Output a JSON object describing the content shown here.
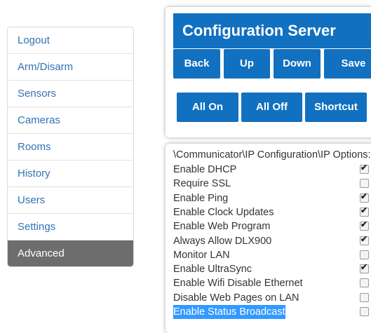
{
  "nav": {
    "items": [
      {
        "label": "Logout",
        "active": false
      },
      {
        "label": "Arm/Disarm",
        "active": false
      },
      {
        "label": "Sensors",
        "active": false
      },
      {
        "label": "Cameras",
        "active": false
      },
      {
        "label": "Rooms",
        "active": false
      },
      {
        "label": "History",
        "active": false
      },
      {
        "label": "Users",
        "active": false
      },
      {
        "label": "Settings",
        "active": false
      },
      {
        "label": "Advanced",
        "active": true
      }
    ]
  },
  "config": {
    "title": "Configuration Server",
    "buttons": {
      "back": "Back",
      "up": "Up",
      "down": "Down",
      "save": "Save",
      "all_on": "All On",
      "all_off": "All Off",
      "shortcut": "Shortcut"
    }
  },
  "options": {
    "path": "\\Communicator\\IP Configuration\\IP Options:",
    "items": [
      {
        "label": "Enable DHCP",
        "checked": true
      },
      {
        "label": "Require SSL",
        "checked": false
      },
      {
        "label": "Enable Ping",
        "checked": true
      },
      {
        "label": "Enable Clock Updates",
        "checked": true
      },
      {
        "label": "Enable Web Program",
        "checked": true
      },
      {
        "label": "Always Allow DLX900",
        "checked": true
      },
      {
        "label": "Monitor LAN",
        "checked": false
      },
      {
        "label": "Enable UltraSync",
        "checked": true
      },
      {
        "label": "Enable Wifi Disable Ethernet",
        "checked": false
      },
      {
        "label": "Disable Web Pages on LAN",
        "checked": false
      },
      {
        "label": "Enable Status Broadcast",
        "checked": false,
        "selected": true
      }
    ]
  },
  "colors": {
    "accent": "#1170c0",
    "nav_link": "#3372b4",
    "nav_active_bg": "#6d6d6d",
    "selection": "#3399ff"
  }
}
